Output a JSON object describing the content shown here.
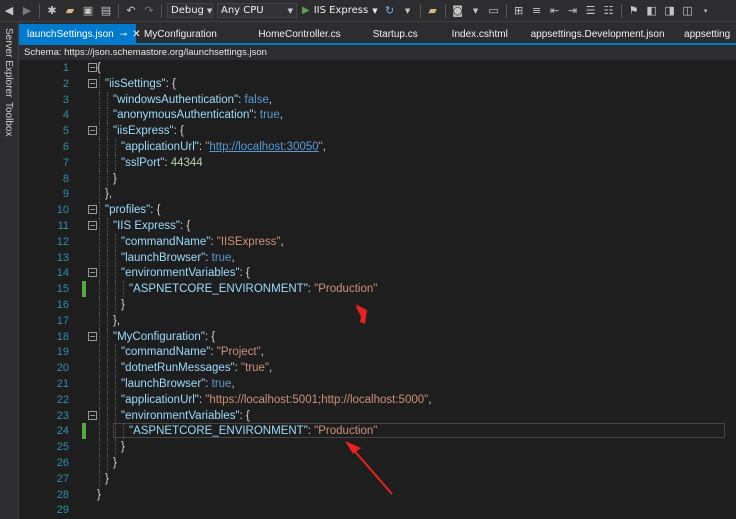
{
  "toolbar": {
    "config": "Debug",
    "platform": "Any CPU",
    "run_target": "IIS Express"
  },
  "side_tabs": [
    "Server Explorer",
    "Toolbox"
  ],
  "tabs": [
    {
      "label": "launchSettings.json",
      "active": true
    },
    {
      "label": "MyConfiguration",
      "active": false
    },
    {
      "label": "HomeController.cs",
      "active": false
    },
    {
      "label": "Startup.cs",
      "active": false
    },
    {
      "label": "Index.cshtml",
      "active": false
    },
    {
      "label": "appsettings.Development.json",
      "active": false
    },
    {
      "label": "appsetting",
      "active": false
    }
  ],
  "schema": "Schema:  https://json.schemastore.org/launchsettings.json",
  "editor": {
    "lines": [
      {
        "n": "1",
        "indent": 0,
        "fold": "−",
        "t": [
          [
            "p",
            "{"
          ]
        ]
      },
      {
        "n": "2",
        "indent": 1,
        "fold": "−",
        "t": [
          [
            "k",
            "\"iisSettings\""
          ],
          [
            "p",
            ": {"
          ]
        ]
      },
      {
        "n": "3",
        "indent": 2,
        "t": [
          [
            "k",
            "\"windowsAuthentication\""
          ],
          [
            "p",
            ": "
          ],
          [
            "b",
            "false"
          ],
          [
            "p",
            ","
          ]
        ]
      },
      {
        "n": "4",
        "indent": 2,
        "t": [
          [
            "k",
            "\"anonymousAuthentication\""
          ],
          [
            "p",
            ": "
          ],
          [
            "b",
            "true"
          ],
          [
            "p",
            ","
          ]
        ]
      },
      {
        "n": "5",
        "indent": 2,
        "fold": "−",
        "t": [
          [
            "k",
            "\"iisExpress\""
          ],
          [
            "p",
            ": {"
          ]
        ]
      },
      {
        "n": "6",
        "indent": 3,
        "t": [
          [
            "k",
            "\"applicationUrl\""
          ],
          [
            "p",
            ": "
          ],
          [
            "s",
            "\""
          ],
          [
            "u",
            "http://localhost:30050"
          ],
          [
            "s",
            "\""
          ],
          [
            "p",
            ","
          ]
        ]
      },
      {
        "n": "7",
        "indent": 3,
        "t": [
          [
            "k",
            "\"sslPort\""
          ],
          [
            "p",
            ": "
          ],
          [
            "n",
            "44344"
          ]
        ]
      },
      {
        "n": "8",
        "indent": 2,
        "t": [
          [
            "p",
            "}"
          ]
        ]
      },
      {
        "n": "9",
        "indent": 1,
        "t": [
          [
            "p",
            "},"
          ]
        ]
      },
      {
        "n": "10",
        "indent": 1,
        "fold": "−",
        "t": [
          [
            "k",
            "\"profiles\""
          ],
          [
            "p",
            ": {"
          ]
        ]
      },
      {
        "n": "11",
        "indent": 2,
        "fold": "−",
        "t": [
          [
            "k",
            "\"IIS Express\""
          ],
          [
            "p",
            ": {"
          ]
        ]
      },
      {
        "n": "12",
        "indent": 3,
        "t": [
          [
            "k",
            "\"commandName\""
          ],
          [
            "p",
            ": "
          ],
          [
            "s",
            "\"IISExpress\""
          ],
          [
            "p",
            ","
          ]
        ]
      },
      {
        "n": "13",
        "indent": 3,
        "t": [
          [
            "k",
            "\"launchBrowser\""
          ],
          [
            "p",
            ": "
          ],
          [
            "b",
            "true"
          ],
          [
            "p",
            ","
          ]
        ]
      },
      {
        "n": "14",
        "indent": 3,
        "fold": "−",
        "t": [
          [
            "k",
            "\"environmentVariables\""
          ],
          [
            "p",
            ": {"
          ]
        ]
      },
      {
        "n": "15",
        "indent": 4,
        "chg": true,
        "t": [
          [
            "k",
            "\"ASPNETCORE_ENVIRONMENT\""
          ],
          [
            "p",
            ": "
          ],
          [
            "s",
            "\"Production\""
          ]
        ]
      },
      {
        "n": "16",
        "indent": 3,
        "t": [
          [
            "p",
            "}"
          ]
        ]
      },
      {
        "n": "17",
        "indent": 2,
        "t": [
          [
            "p",
            "},"
          ]
        ]
      },
      {
        "n": "18",
        "indent": 2,
        "fold": "−",
        "t": [
          [
            "k",
            "\"MyConfiguration\""
          ],
          [
            "p",
            ": {"
          ]
        ]
      },
      {
        "n": "19",
        "indent": 3,
        "t": [
          [
            "k",
            "\"commandName\""
          ],
          [
            "p",
            ": "
          ],
          [
            "s",
            "\"Project\""
          ],
          [
            "p",
            ","
          ]
        ]
      },
      {
        "n": "20",
        "indent": 3,
        "t": [
          [
            "k",
            "\"dotnetRunMessages\""
          ],
          [
            "p",
            ": "
          ],
          [
            "s",
            "\"true\""
          ],
          [
            "p",
            ","
          ]
        ]
      },
      {
        "n": "21",
        "indent": 3,
        "t": [
          [
            "k",
            "\"launchBrowser\""
          ],
          [
            "p",
            ": "
          ],
          [
            "b",
            "true"
          ],
          [
            "p",
            ","
          ]
        ]
      },
      {
        "n": "22",
        "indent": 3,
        "t": [
          [
            "k",
            "\"applicationUrl\""
          ],
          [
            "p",
            ": "
          ],
          [
            "s",
            "\"https://localhost:5001;http://localhost:5000\""
          ],
          [
            "p",
            ","
          ]
        ]
      },
      {
        "n": "23",
        "indent": 3,
        "fold": "−",
        "t": [
          [
            "k",
            "\"environmentVariables\""
          ],
          [
            "p",
            ": {"
          ]
        ]
      },
      {
        "n": "24",
        "indent": 4,
        "chg": true,
        "cur": true,
        "t": [
          [
            "k",
            "\"ASPNETCORE_ENVIRONMENT\""
          ],
          [
            "p",
            ": "
          ],
          [
            "s",
            "\"Production\""
          ]
        ]
      },
      {
        "n": "25",
        "indent": 3,
        "t": [
          [
            "p",
            "}"
          ]
        ]
      },
      {
        "n": "26",
        "indent": 2,
        "t": [
          [
            "p",
            "}"
          ]
        ]
      },
      {
        "n": "27",
        "indent": 1,
        "t": [
          [
            "p",
            "}"
          ]
        ]
      },
      {
        "n": "28",
        "indent": 0,
        "t": [
          [
            "p",
            "}"
          ]
        ]
      },
      {
        "n": "29",
        "indent": 0,
        "t": []
      }
    ]
  },
  "colors": {
    "accent": "#007acc",
    "annotation": "#e8231f",
    "change_bar": "#57a64a"
  }
}
